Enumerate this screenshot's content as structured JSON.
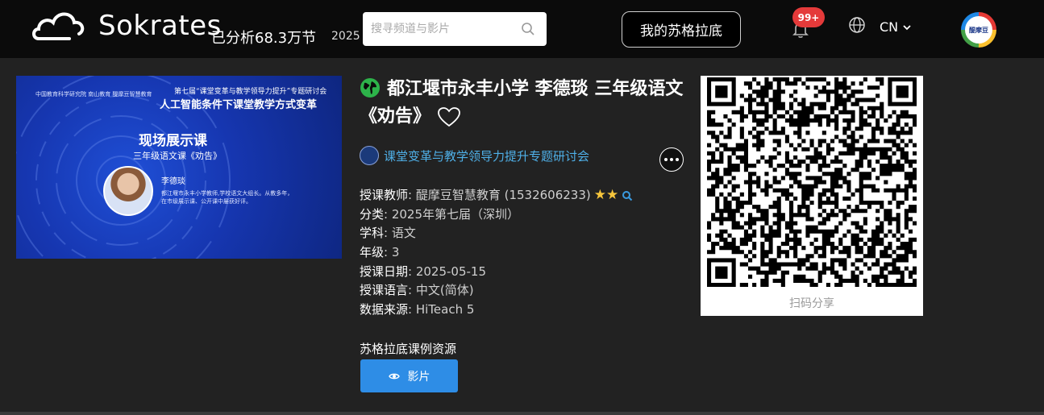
{
  "header": {
    "logo_text": "Sokrates",
    "analyzed_label": "已分析68.3万节",
    "analyzed_year": "2025",
    "search_placeholder": "搜寻频道与影片",
    "my_button": "我的苏格拉底",
    "notification_badge": "99+",
    "language": "CN",
    "avatar_text": "醍摩豆"
  },
  "thumbnail": {
    "logos_text": "中国教育科学研究院  南山教育  醍摩豆智慧教育",
    "line1": "第七届“课堂变革与教学领导力提升”专题研讨会",
    "line2": "人工智能条件下课堂教学方式变革",
    "title": "现场展示课",
    "subtitle": "三年级语文课《劝告》",
    "teacher_name": "李德琰",
    "bio": "都江堰市永丰小学教师,学校语文大组长。从教多年，在市级展示课、公开课中屡获好评。"
  },
  "course": {
    "title": "都江堰市永丰小学 李德琰 三年级语文《劝告》",
    "org_name": "课堂变革与教学领导力提升专题研讨会",
    "meta": [
      {
        "key": "授课教师",
        "value": ": 醍摩豆智慧教育 (1532606233)"
      },
      {
        "key": "分类",
        "value": ": 2025年第七届（深圳）"
      },
      {
        "key": "学科",
        "value": ": 语文"
      },
      {
        "key": "年级",
        "value": ": 3"
      },
      {
        "key": "授课日期",
        "value": ": 2025-05-15"
      },
      {
        "key": "授课语言",
        "value": ": 中文(简体)"
      },
      {
        "key": "数据来源",
        "value": ": HiTeach 5"
      }
    ],
    "teacher_stars": 2,
    "star_glyph": "★",
    "resources_title": "苏格拉底课例资源",
    "video_button": "影片"
  },
  "qr": {
    "caption": "扫码分享"
  },
  "colors": {
    "accent_blue": "#2e8de6",
    "org_link": "#4fb0e8",
    "badge_red": "#e43a3a",
    "star_gold": "#f7c63c",
    "globe_green": "#2db34a"
  }
}
